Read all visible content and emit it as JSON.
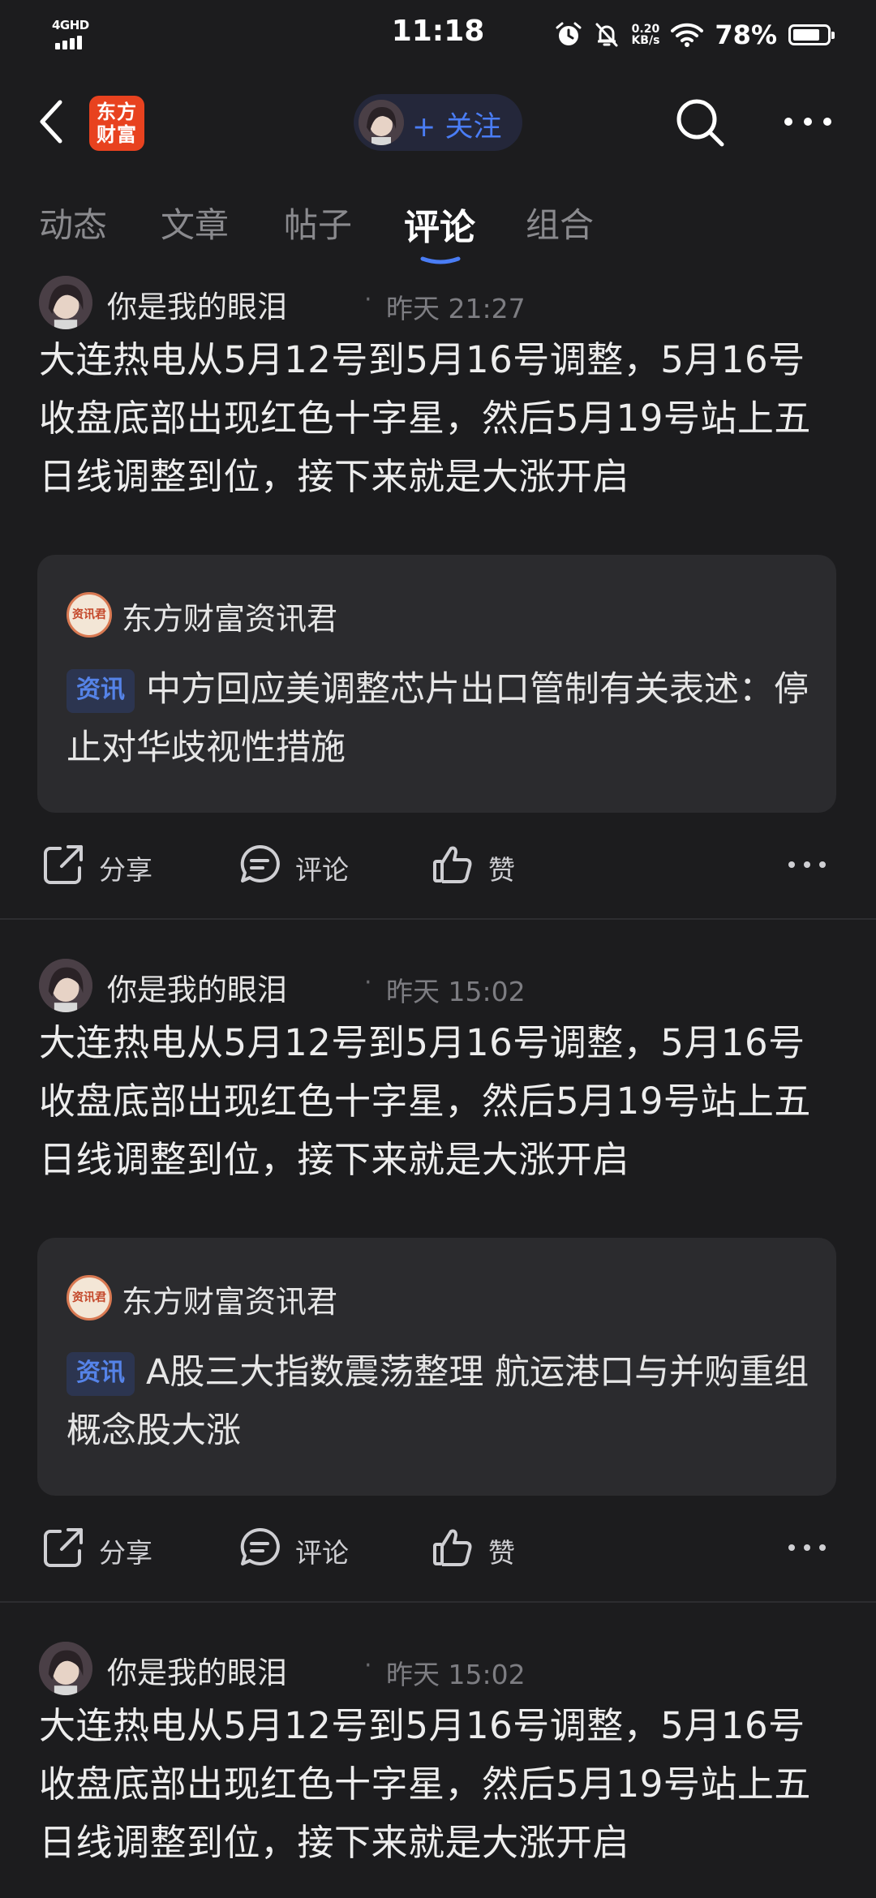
{
  "status_bar": {
    "network": "4GHD",
    "time": "11:18",
    "speed_value": "0.20",
    "speed_unit": "KB/s",
    "battery": "78%"
  },
  "header": {
    "logo_line1": "东方",
    "logo_line2": "财富",
    "follow_label": "+ 关注",
    "icons": [
      "chevron-left-icon",
      "search-icon",
      "more-dots-icon"
    ]
  },
  "tabs": [
    {
      "label": "动态",
      "active": false
    },
    {
      "label": "文章",
      "active": false
    },
    {
      "label": "帖子",
      "active": false
    },
    {
      "label": "评论",
      "active": true
    },
    {
      "label": "组合",
      "active": false
    }
  ],
  "posts": [
    {
      "author": "你是我的眼泪",
      "time": "昨天 21:27",
      "text": "大连热电从5月12号到5月16号调整，5月16号收盘底部出现红色十字星，然后5月19号站上五日线调整到位，接下来就是大涨开启",
      "card": {
        "logo_text": "资讯君",
        "source": "东方财富资讯君",
        "tag": "资讯",
        "text": "中方回应美调整芯片出口管制有关表述：停止对华歧视性措施"
      },
      "actions": {
        "share": "分享",
        "comment": "评论",
        "like": "赞"
      }
    },
    {
      "author": "你是我的眼泪",
      "time": "昨天 15:02",
      "text": "大连热电从5月12号到5月16号调整，5月16号收盘底部出现红色十字星，然后5月19号站上五日线调整到位，接下来就是大涨开启",
      "card": {
        "logo_text": "资讯君",
        "source": "东方财富资讯君",
        "tag": "资讯",
        "text": "A股三大指数震荡整理 航运港口与并购重组概念股大涨"
      },
      "actions": {
        "share": "分享",
        "comment": "评论",
        "like": "赞"
      }
    },
    {
      "author": "你是我的眼泪",
      "time": "昨天 15:02",
      "text": "大连热电从5月12号到5月16号调整，5月16号收盘底部出现红色十字星，然后5月19号站上五日线调整到位，接下来就是大涨开启"
    }
  ],
  "colors": {
    "background": "#1c1c1e",
    "accent": "#4a7df5",
    "card": "#2b2b2e",
    "brand": "#e8421f"
  }
}
